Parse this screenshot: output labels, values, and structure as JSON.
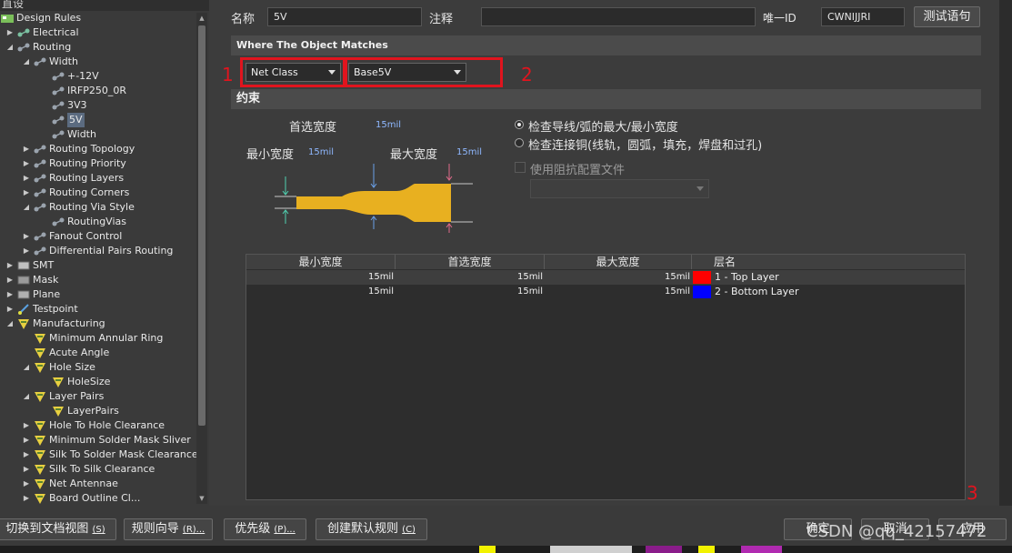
{
  "tree": {
    "header": "直设",
    "items": [
      {
        "label": "Design Rules",
        "level": 0,
        "exp": "open",
        "icon": "design-rules-icon"
      },
      {
        "label": "Electrical",
        "level": 1,
        "exp": "closed",
        "icon": "electrical-icon"
      },
      {
        "label": "Routing",
        "level": 1,
        "exp": "open",
        "icon": "routing-icon"
      },
      {
        "label": "Width",
        "level": 2,
        "exp": "open",
        "icon": "routing-icon"
      },
      {
        "label": "+-12V",
        "level": 3,
        "exp": "none",
        "icon": "routing-icon"
      },
      {
        "label": "IRFP250_0R",
        "level": 3,
        "exp": "none",
        "icon": "routing-icon"
      },
      {
        "label": "3V3",
        "level": 3,
        "exp": "none",
        "icon": "routing-icon"
      },
      {
        "label": "5V",
        "level": 3,
        "exp": "none",
        "icon": "routing-icon",
        "selected": true
      },
      {
        "label": "Width",
        "level": 3,
        "exp": "none",
        "icon": "routing-icon"
      },
      {
        "label": "Routing Topology",
        "level": 2,
        "exp": "closed",
        "icon": "routing-icon"
      },
      {
        "label": "Routing Priority",
        "level": 2,
        "exp": "closed",
        "icon": "routing-icon"
      },
      {
        "label": "Routing Layers",
        "level": 2,
        "exp": "closed",
        "icon": "routing-icon"
      },
      {
        "label": "Routing Corners",
        "level": 2,
        "exp": "closed",
        "icon": "routing-icon"
      },
      {
        "label": "Routing Via Style",
        "level": 2,
        "exp": "open",
        "icon": "routing-icon"
      },
      {
        "label": "RoutingVias",
        "level": 3,
        "exp": "none",
        "icon": "routing-icon"
      },
      {
        "label": "Fanout Control",
        "level": 2,
        "exp": "closed",
        "icon": "routing-icon"
      },
      {
        "label": "Differential Pairs Routing",
        "level": 2,
        "exp": "closed",
        "icon": "routing-icon"
      },
      {
        "label": "SMT",
        "level": 1,
        "exp": "closed",
        "icon": "smt-icon"
      },
      {
        "label": "Mask",
        "level": 1,
        "exp": "closed",
        "icon": "mask-icon"
      },
      {
        "label": "Plane",
        "level": 1,
        "exp": "closed",
        "icon": "plane-icon"
      },
      {
        "label": "Testpoint",
        "level": 1,
        "exp": "closed",
        "icon": "testpoint-icon"
      },
      {
        "label": "Manufacturing",
        "level": 1,
        "exp": "open",
        "icon": "manufacturing-icon"
      },
      {
        "label": "Minimum Annular Ring",
        "level": 2,
        "exp": "none",
        "icon": "manufacturing-icon"
      },
      {
        "label": "Acute Angle",
        "level": 2,
        "exp": "none",
        "icon": "manufacturing-icon"
      },
      {
        "label": "Hole Size",
        "level": 2,
        "exp": "open",
        "icon": "manufacturing-icon"
      },
      {
        "label": "HoleSize",
        "level": 3,
        "exp": "none",
        "icon": "manufacturing-icon"
      },
      {
        "label": "Layer Pairs",
        "level": 2,
        "exp": "open",
        "icon": "manufacturing-icon"
      },
      {
        "label": "LayerPairs",
        "level": 3,
        "exp": "none",
        "icon": "manufacturing-icon"
      },
      {
        "label": "Hole To Hole Clearance",
        "level": 2,
        "exp": "closed",
        "icon": "manufacturing-icon"
      },
      {
        "label": "Minimum Solder Mask Sliver",
        "level": 2,
        "exp": "closed",
        "icon": "manufacturing-icon"
      },
      {
        "label": "Silk To Solder Mask Clearance",
        "level": 2,
        "exp": "closed",
        "icon": "manufacturing-icon"
      },
      {
        "label": "Silk To Silk Clearance",
        "level": 2,
        "exp": "closed",
        "icon": "manufacturing-icon"
      },
      {
        "label": "Net Antennae",
        "level": 2,
        "exp": "closed",
        "icon": "manufacturing-icon"
      },
      {
        "label": "Board Outline Cl...",
        "level": 2,
        "exp": "closed",
        "icon": "manufacturing-icon"
      }
    ]
  },
  "rule": {
    "name_label": "名称",
    "name_value": "5V",
    "comment_label": "注释",
    "comment_value": "",
    "uid_label": "唯一ID",
    "uid_value": "CWNIJJRI",
    "test_button": "测试语句"
  },
  "where": {
    "title": "Where The Object Matches",
    "scope_combo": "Net Class",
    "target_combo": "Base5V"
  },
  "constraints": {
    "title": "约束",
    "preferred_label": "首选宽度",
    "preferred_value": "15mil",
    "min_label": "最小宽度",
    "min_value": "15mil",
    "max_label": "最大宽度",
    "max_value": "15mil",
    "radio1": "检查导线/弧的最大/最小宽度",
    "radio2": "检查连接铜(线轨，圆弧，填充，焊盘和过孔)",
    "impedance_checkbox": "使用阻抗配置文件",
    "impedance_combo": ""
  },
  "table": {
    "headers": [
      "最小宽度",
      "首选宽度",
      "最大宽度",
      "层名"
    ],
    "rows": [
      {
        "min": "15mil",
        "pref": "15mil",
        "max": "15mil",
        "color": "#ff0000",
        "layer": "1 - Top Layer"
      },
      {
        "min": "15mil",
        "pref": "15mil",
        "max": "15mil",
        "color": "#0000ff",
        "layer": "2 - Bottom Layer"
      }
    ]
  },
  "annotations": {
    "n1": "1",
    "n2": "2",
    "n3": "3"
  },
  "bottom": {
    "switch_view": "切换到文档视图",
    "switch_view_key": "(S)",
    "rule_wizard": "规则向导",
    "rule_wizard_key": "(R)...",
    "priority": "优先级",
    "priority_key": "(P)...",
    "create_default": "创建默认规则",
    "create_default_key": "(C)",
    "ok": "确定",
    "cancel": "取消",
    "apply": "应用"
  },
  "watermark": "CSDN @qq_42157472",
  "colors": {
    "annotation_red": "#e0141e",
    "trace_gold": "#e8b020",
    "value_blue": "#8fb8ff"
  }
}
